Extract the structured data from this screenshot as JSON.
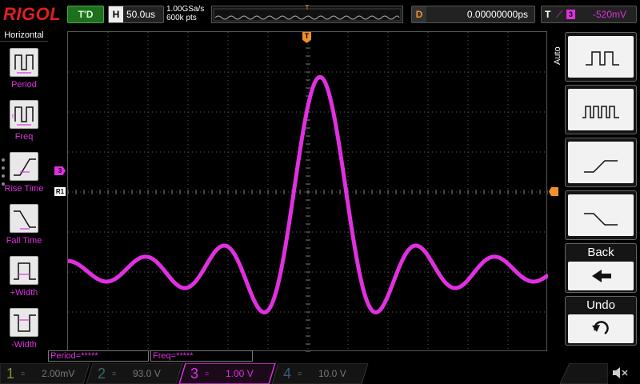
{
  "brand": "RIGOL",
  "trigger_status": "T'D",
  "horizontal": {
    "label": "H",
    "value": "50.0us"
  },
  "sampling": {
    "rate": "1.00GSa/s",
    "points": "600k pts"
  },
  "memory_trigger_marker": "T",
  "delay": {
    "label": "D",
    "value": "0.00000000ps"
  },
  "trigger": {
    "label": "T",
    "edge": "⟋",
    "source": "3",
    "level": "-520mV"
  },
  "left_menu": {
    "title": "Horizontal",
    "items": [
      {
        "label": "Period",
        "icon": "period-icon"
      },
      {
        "label": "Freq",
        "icon": "freq-icon"
      },
      {
        "label": "Rise Time",
        "icon": "rise-time-icon"
      },
      {
        "label": "Fall Time",
        "icon": "fall-time-icon"
      },
      {
        "label": "+Width",
        "icon": "plus-width-icon"
      },
      {
        "label": "-Width",
        "icon": "minus-width-icon"
      }
    ]
  },
  "markers": {
    "channel": "3",
    "reference": "R1",
    "trigger_pos": "T"
  },
  "right_menu": {
    "tab": "Auto",
    "buttons": [
      {
        "label": "",
        "icon": "single-pulse-icon"
      },
      {
        "label": "",
        "icon": "pulse-train-icon"
      },
      {
        "label": "",
        "icon": "rising-edge-icon"
      },
      {
        "label": "",
        "icon": "falling-edge-icon"
      },
      {
        "label": "Back",
        "icon": "back-arrow-icon"
      },
      {
        "label": "Undo",
        "icon": "undo-icon"
      }
    ]
  },
  "measurements": {
    "period": "Period=*****",
    "freq": "Freq=*****"
  },
  "channels": [
    {
      "num": "1",
      "coupling": "=",
      "scale": "2.00mV",
      "color": "#8a8a3a"
    },
    {
      "num": "2",
      "coupling": "=",
      "scale": "93.0 V",
      "color": "#3a6a6a"
    },
    {
      "num": "3",
      "coupling": "=",
      "scale": "1.00 V",
      "color": "#e030e0"
    },
    {
      "num": "4",
      "coupling": "=",
      "scale": "10.0 V",
      "color": "#3a5a7a"
    }
  ],
  "colors": {
    "trace": "#e030e0",
    "trigger_marker": "#f0902a",
    "grid": "#5a5a5a"
  },
  "waveform": {
    "shape": "sinc",
    "peak_div": 3.2,
    "baseline_div": -2.0
  }
}
